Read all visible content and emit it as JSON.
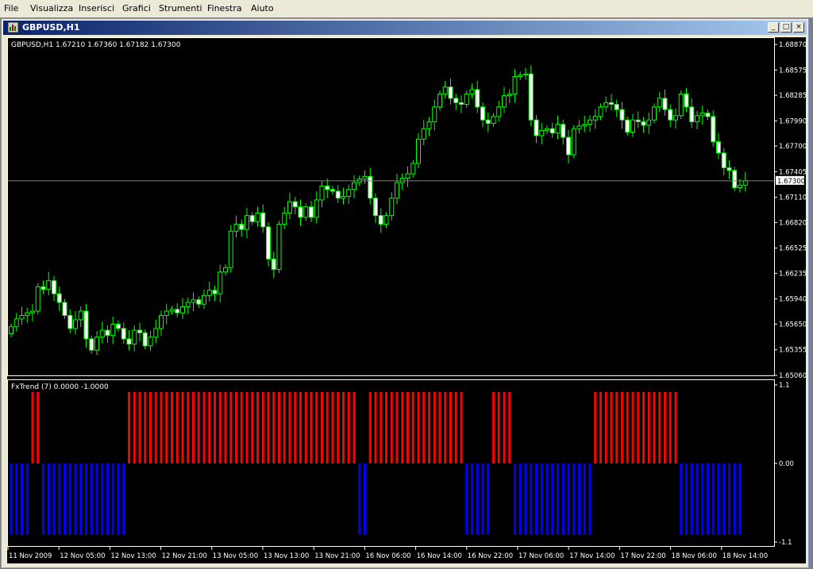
{
  "menu": [
    "File",
    "Visualizza",
    "Inserisci",
    "Grafici",
    "Strumenti",
    "Finestra",
    "Aiuto"
  ],
  "window": {
    "title": "GBPUSD,H1",
    "icon": "chart-window-icon",
    "buttons": [
      "minimize",
      "maximize",
      "close"
    ]
  },
  "price_chart": {
    "header": "GBPUSD,H1  1.67210 1.67360 1.67182 1.67300",
    "price_ticks": [
      "1.68870",
      "1.68575",
      "1.68285",
      "1.67990",
      "1.67700",
      "1.67405",
      "1.67110",
      "1.66820",
      "1.66525",
      "1.66235",
      "1.65940",
      "1.65650",
      "1.65355",
      "1.65060"
    ],
    "current_price": "1.67300",
    "colors": {
      "background": "#000000",
      "candle": "#00ff00",
      "bull_body": "#000000",
      "bear_body": "#ffffff",
      "price_line": "#808080",
      "tick_text": "#ffffff"
    }
  },
  "indicator": {
    "header": "FxTrend (7) 0.0000 -1.0000",
    "ticks": [
      "1.1",
      "0.00",
      "-1.1"
    ],
    "colors": {
      "up": "#ff0000",
      "down": "#0000ff"
    }
  },
  "time_axis": [
    "11 Nov 2009",
    "12 Nov 05:00",
    "12 Nov 13:00",
    "12 Nov 21:00",
    "13 Nov 05:00",
    "13 Nov 13:00",
    "13 Nov 21:00",
    "16 Nov 06:00",
    "16 Nov 14:00",
    "16 Nov 22:00",
    "17 Nov 06:00",
    "17 Nov 14:00",
    "17 Nov 22:00",
    "18 Nov 06:00",
    "18 Nov 14:00"
  ],
  "chart_data": {
    "type": "candlestick",
    "symbol": "GBPUSD",
    "timeframe": "H1",
    "ylim": [
      1.6506,
      1.6887
    ],
    "close": [
      1.6562,
      1.6571,
      1.6575,
      1.6578,
      1.658,
      1.6608,
      1.6605,
      1.6615,
      1.66,
      1.659,
      1.6575,
      1.656,
      1.657,
      1.658,
      1.6548,
      1.6535,
      1.655,
      1.6558,
      1.6552,
      1.6565,
      1.656,
      1.6548,
      1.6542,
      1.6558,
      1.6555,
      1.654,
      1.655,
      1.656,
      1.6575,
      1.658,
      1.6582,
      1.6578,
      1.6585,
      1.659,
      1.6593,
      1.6588,
      1.6598,
      1.6604,
      1.66,
      1.6625,
      1.663,
      1.6672,
      1.668,
      1.6674,
      1.669,
      1.6683,
      1.6693,
      1.6677,
      1.664,
      1.6628,
      1.668,
      1.6693,
      1.6706,
      1.67,
      1.6688,
      1.67,
      1.6688,
      1.6708,
      1.6724,
      1.672,
      1.6718,
      1.671,
      1.6712,
      1.672,
      1.6728,
      1.6732,
      1.6735,
      1.671,
      1.669,
      1.668,
      1.669,
      1.671,
      1.6728,
      1.6733,
      1.6738,
      1.675,
      1.6778,
      1.679,
      1.6798,
      1.6815,
      1.683,
      1.6838,
      1.6825,
      1.682,
      1.6818,
      1.683,
      1.6835,
      1.6815,
      1.68,
      1.6796,
      1.6804,
      1.6815,
      1.6828,
      1.683,
      1.685,
      1.6852,
      1.6853,
      1.68,
      1.6782,
      1.6788,
      1.679,
      1.6785,
      1.6795,
      1.678,
      1.676,
      1.679,
      1.6793,
      1.6795,
      1.68,
      1.6804,
      1.6815,
      1.682,
      1.6818,
      1.6812,
      1.68,
      1.6786,
      1.68,
      1.6798,
      1.6794,
      1.68,
      1.6815,
      1.6825,
      1.6812,
      1.68,
      1.6805,
      1.683,
      1.6815,
      1.6798,
      1.6805,
      1.6808,
      1.6804,
      1.6775,
      1.6762,
      1.6745,
      1.6742,
      1.6722,
      1.6725,
      1.673
    ],
    "indicator_values": [
      -1,
      -1,
      -1,
      -1,
      1,
      1,
      -1,
      -1,
      -1,
      -1,
      -1,
      -1,
      -1,
      -1,
      -1,
      -1,
      -1,
      -1,
      -1,
      -1,
      -1,
      -1,
      1,
      1,
      1,
      1,
      1,
      1,
      1,
      1,
      1,
      1,
      1,
      1,
      1,
      1,
      1,
      1,
      1,
      1,
      1,
      1,
      1,
      1,
      1,
      1,
      1,
      1,
      1,
      1,
      1,
      1,
      1,
      1,
      1,
      1,
      1,
      1,
      1,
      1,
      1,
      1,
      1,
      1,
      1,
      -1,
      -1,
      1,
      1,
      1,
      1,
      1,
      1,
      1,
      1,
      1,
      1,
      1,
      1,
      1,
      1,
      1,
      1,
      1,
      1,
      -1,
      -1,
      -1,
      -1,
      -1,
      1,
      1,
      1,
      1,
      -1,
      -1,
      -1,
      -1,
      -1,
      -1,
      -1,
      -1,
      -1,
      -1,
      -1,
      -1,
      -1,
      -1,
      -1,
      1,
      1,
      1,
      1,
      1,
      1,
      1,
      1,
      1,
      1,
      1,
      1,
      1,
      1,
      1,
      1,
      -1,
      -1,
      -1,
      -1,
      -1,
      -1,
      -1,
      -1,
      -1,
      -1,
      -1,
      -1
    ]
  }
}
